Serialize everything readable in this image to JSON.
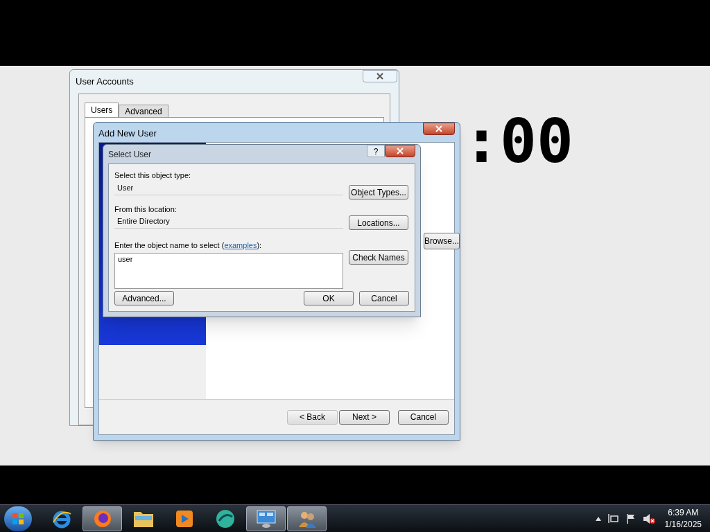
{
  "background_clock": {
    "text": ":00"
  },
  "user_accounts": {
    "title": "User Accounts",
    "tabs": [
      {
        "label": "Users",
        "selected": true
      },
      {
        "label": "Advanced",
        "selected": false
      }
    ]
  },
  "add_new_user": {
    "title": "Add New User",
    "browse_button": "Browse...",
    "buttons": [
      {
        "label": "< Back",
        "disabled": true
      },
      {
        "label": "Next >",
        "disabled": false
      },
      {
        "label": "Cancel",
        "disabled": false
      }
    ]
  },
  "select_user": {
    "title": "Select User",
    "help": "?",
    "object_type_label": "Select this object type:",
    "object_type": "User",
    "object_types_button": "Object Types...",
    "location_label": "From this location:",
    "location": "Entire Directory",
    "locations_button": "Locations...",
    "name_label": "Enter the object name to select (",
    "examples_link": "examples",
    "name_label_end": "):",
    "name_value": "user",
    "check_names_button": "Check Names",
    "advanced_button": "Advanced...",
    "ok_button": "OK",
    "cancel_button": "Cancel"
  },
  "taskbar": {
    "apps": [
      {
        "kind": "ie",
        "active": false
      },
      {
        "kind": "firefox",
        "active": true
      },
      {
        "kind": "folder",
        "active": false
      },
      {
        "kind": "media",
        "active": false
      },
      {
        "kind": "globe",
        "active": false
      },
      {
        "kind": "control",
        "active": true
      },
      {
        "kind": "users",
        "active": true
      }
    ],
    "time": "6:39 AM",
    "date": "1/16/2025"
  }
}
